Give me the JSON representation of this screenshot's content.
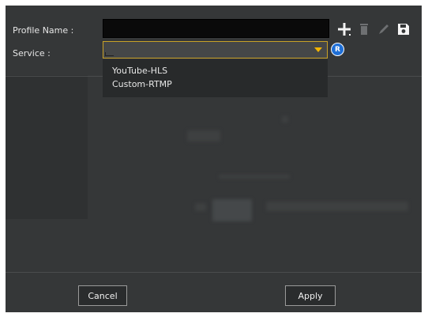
{
  "form": {
    "profile_name_label": "Profile Name :",
    "profile_name_value": "",
    "service_label": "Service :",
    "service_selected": "",
    "info_badge": "R"
  },
  "toolbar": {
    "icons": [
      "plus-icon",
      "trash-icon",
      "pencil-icon",
      "save-icon"
    ]
  },
  "dropdown": {
    "options": [
      "YouTube-HLS",
      "Custom-RTMP"
    ]
  },
  "footer": {
    "cancel_label": "Cancel",
    "apply_label": "Apply"
  },
  "colors": {
    "dialog_bg": "#353738",
    "select_border": "#c9a227",
    "caret": "#f2b400",
    "info_badge": "#1f6fd6"
  }
}
